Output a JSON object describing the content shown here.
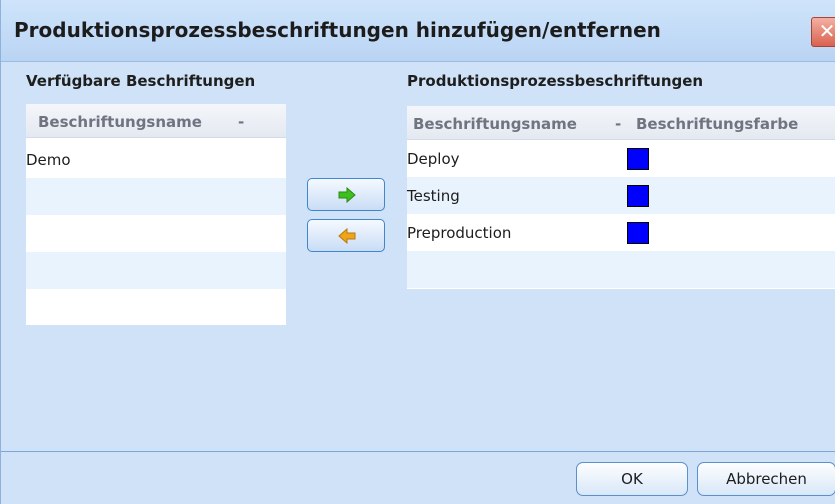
{
  "dialog": {
    "title": "Produktionsprozessbeschriftungen hinzufügen/entfernen",
    "close_glyph": "✕"
  },
  "available": {
    "section_label": "Verfügbare Beschriftungen",
    "column_header": "Beschriftungsname",
    "sort_indicator": "-",
    "rows": [
      "Demo"
    ]
  },
  "process": {
    "section_label": "Produktionsprozessbeschriftungen",
    "column_header_name": "Beschriftungsname",
    "sort_indicator": "-",
    "column_header_color": "Beschriftungsfarbe",
    "rows": [
      {
        "name": "Deploy",
        "color": "#0000ff"
      },
      {
        "name": "Testing",
        "color": "#0000ff"
      },
      {
        "name": "Preproduction",
        "color": "#0000ff"
      }
    ]
  },
  "move_buttons": {
    "add_icon": "arrow-right-icon",
    "add_color": "#3fbf1f",
    "remove_icon": "arrow-left-icon",
    "remove_color": "#f0a418"
  },
  "footer": {
    "ok_label": "OK",
    "cancel_label": "Abbrechen"
  }
}
